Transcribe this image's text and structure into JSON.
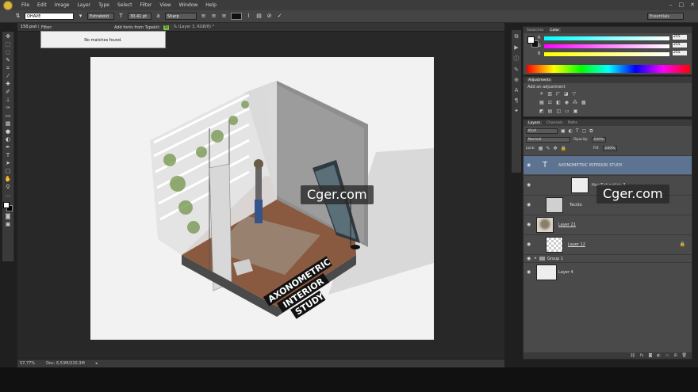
{
  "menu": [
    "File",
    "Edit",
    "Image",
    "Layer",
    "Type",
    "Select",
    "Filter",
    "View",
    "Window",
    "Help"
  ],
  "options": {
    "font_family": "OHAVE",
    "font_style": "Extrabold",
    "font_size": "30,41 pt",
    "aa_label": "a",
    "aa_value": "Sharp",
    "workspace": "Essentials"
  },
  "font_dropdown": {
    "filter_label": "Filter:",
    "typekit_label": "Add fonts from Typekit:",
    "typekit_badge": "Tk",
    "no_match": "No matches found."
  },
  "document_tab": "150.psd @",
  "document_tab_2": "367% (Layer 3, RGB/8) *",
  "status": {
    "zoom": "57,77%",
    "doc": "Doc: 6,53M/220,3M"
  },
  "panels": {
    "color_tabs": [
      "Swatches",
      "Color"
    ],
    "color_channels": [
      {
        "name": "R",
        "value": "255"
      },
      {
        "name": "G",
        "value": "255"
      },
      {
        "name": "B",
        "value": "255"
      }
    ],
    "adj_tab": "Adjustments",
    "adj_title": "Add an adjustment",
    "layers_tabs": [
      "Layers",
      "Channels",
      "Paths"
    ],
    "kind_label": "Kind",
    "blend_mode": "Normal",
    "opacity_label": "Opacity:",
    "opacity_value": "100%",
    "lock_label": "Lock:",
    "fill_label": "Fill:",
    "fill_value": "100%"
  },
  "layers": [
    {
      "name": "AXONOMETRIC INTERIOR STUDY",
      "thumb": "T"
    },
    {
      "name": "Hue/Saturation 3"
    },
    {
      "name": "Tecido"
    },
    {
      "name": "Layer 21"
    },
    {
      "name": "Layer 12"
    },
    {
      "name": "Group 1"
    },
    {
      "name": "Layer 4"
    }
  ],
  "artwork": {
    "title_line1": "AXONOMETRIC",
    "title_line2": "INTERIOR",
    "title_line3": "STUDY"
  },
  "watermark": "Cger.com"
}
